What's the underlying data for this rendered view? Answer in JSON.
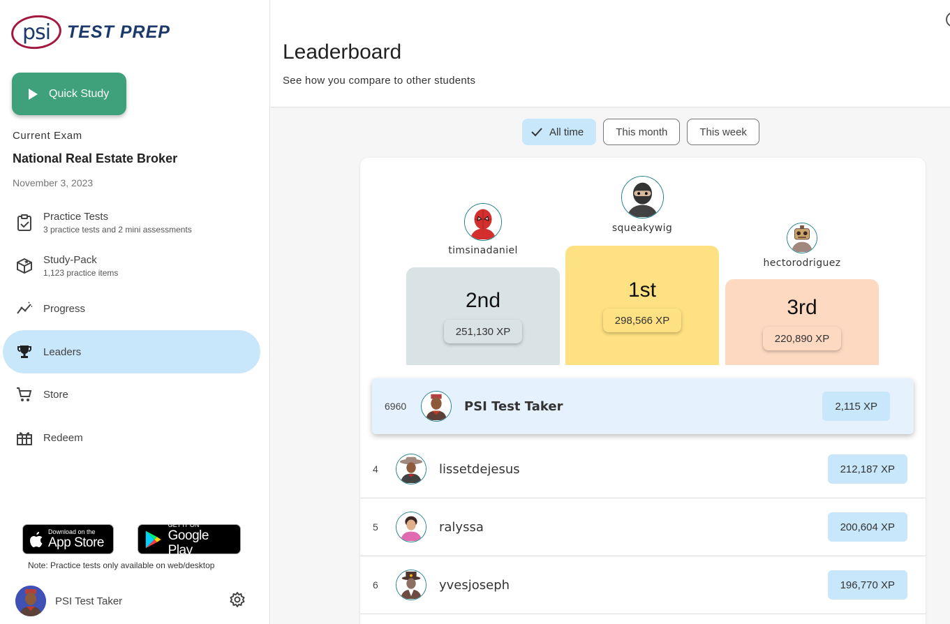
{
  "brand": {
    "logo_mark": "psi",
    "product": "TEST PREP"
  },
  "sidebar": {
    "quick_study_label": "Quick Study",
    "current_exam_label": "Current Exam",
    "exam_name": "National Real Estate Broker",
    "exam_date": "November 3, 2023",
    "items": [
      {
        "label": "Practice Tests",
        "sub": "3 practice tests and 2 mini assessments",
        "icon": "clipboard-check-icon"
      },
      {
        "label": "Study-Pack",
        "sub": "1,123 practice items",
        "icon": "box-star-icon"
      },
      {
        "label": "Progress",
        "sub": "",
        "icon": "progress-chart-icon"
      },
      {
        "label": "Leaders",
        "sub": "",
        "icon": "trophy-icon",
        "active": true
      },
      {
        "label": "Store",
        "sub": "",
        "icon": "cart-icon"
      },
      {
        "label": "Redeem",
        "sub": "",
        "icon": "gift-icon"
      }
    ],
    "app_store": {
      "small": "Download on the",
      "big": "App Store"
    },
    "google_play": {
      "small": "GET IT ON",
      "big": "Google Play"
    },
    "note": "Note: Practice tests only available on web/desktop",
    "user_name": "PSI Test Taker"
  },
  "main": {
    "title": "Leaderboard",
    "subtitle": "See how you compare to other students",
    "filters": [
      "All time",
      "This month",
      "This week"
    ],
    "selected_filter": "All time",
    "podium": {
      "first": {
        "rank": "1st",
        "name": "squeakywig",
        "xp": "298,566 XP",
        "color": "#fde182"
      },
      "second": {
        "rank": "2nd",
        "name": "timsinadaniel",
        "xp": "251,130 XP",
        "color": "#d9e2e5"
      },
      "third": {
        "rank": "3rd",
        "name": "hectorodriguez",
        "xp": "220,890 XP",
        "color": "#fdd9c2"
      }
    },
    "me": {
      "rank": "6960",
      "name": "PSI Test Taker",
      "xp": "2,115 XP"
    },
    "rows": [
      {
        "rank": "4",
        "name": "lissetdejesus",
        "xp": "212,187 XP"
      },
      {
        "rank": "5",
        "name": "ralyssa",
        "xp": "200,604 XP"
      },
      {
        "rank": "6",
        "name": "yvesjoseph",
        "xp": "196,770 XP"
      }
    ]
  }
}
